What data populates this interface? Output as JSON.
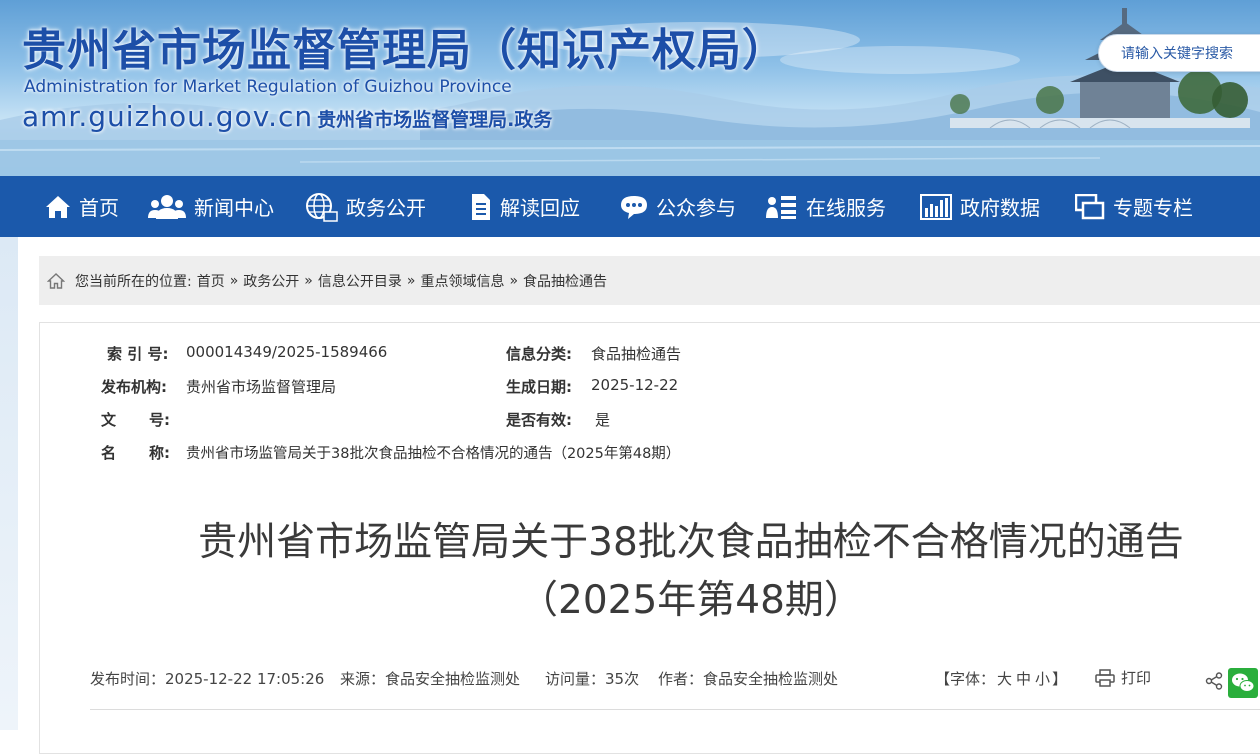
{
  "header": {
    "title": "贵州省市场监督管理局（知识产权局）",
    "english": "Administration for Market Regulation of Guizhou Province",
    "domain": "amr.guizhou.gov.cn",
    "gov_suffix": "贵州省市场监督管理局.政务",
    "search_placeholder": "请输入关键字搜索"
  },
  "nav": [
    {
      "label": "首页",
      "icon": "home-icon"
    },
    {
      "label": "新闻中心",
      "icon": "people-icon"
    },
    {
      "label": "政务公开",
      "icon": "globe-icon"
    },
    {
      "label": "解读回应",
      "icon": "document-icon"
    },
    {
      "label": "公众参与",
      "icon": "chat-bubble-icon"
    },
    {
      "label": "在线服务",
      "icon": "user-list-icon"
    },
    {
      "label": "政府数据",
      "icon": "bar-chart-icon"
    },
    {
      "label": "专题专栏",
      "icon": "windows-icon"
    }
  ],
  "breadcrumb": {
    "prefix": "您当前所在的位置:",
    "items": [
      "首页",
      "政务公开",
      "信息公开目录",
      "重点领域信息",
      "食品抽检通告"
    ],
    "separator": "»"
  },
  "meta": {
    "index_label": "索 引 号:",
    "index_value": "000014349/2025-1589466",
    "category_label": "信息分类:",
    "category_value": "食品抽检通告",
    "publisher_label": "发布机构:",
    "publisher_value": "贵州省市场监督管理局",
    "date_label": "生成日期:",
    "date_value": "2025-12-22",
    "docno_label_1": "文",
    "docno_label_2": "号:",
    "valid_label": "是否有效:",
    "valid_value": "是",
    "name_label_1": "名",
    "name_label_2": "称:",
    "name_value": "贵州省市场监管局关于38批次食品抽检不合格情况的通告（2025年第48期）"
  },
  "article": {
    "title_line1": "贵州省市场监管局关于38批次食品抽检不合格情况的通告",
    "title_line2": "（2025年第48期）",
    "publish_time": "发布时间：2025-12-22 17:05:26",
    "source": "来源：食品安全抽检监测处",
    "visits": "访问量：35次",
    "author": "作者：食品安全抽检监测处",
    "font_label": "【字体：",
    "font_large": "大",
    "font_medium": "中",
    "font_small": "小",
    "font_close": "】",
    "print_label": "打印"
  },
  "colors": {
    "nav_bg": "#1b59ab",
    "title_blue": "#1d4fa8",
    "wechat_green": "#2aae3c"
  }
}
